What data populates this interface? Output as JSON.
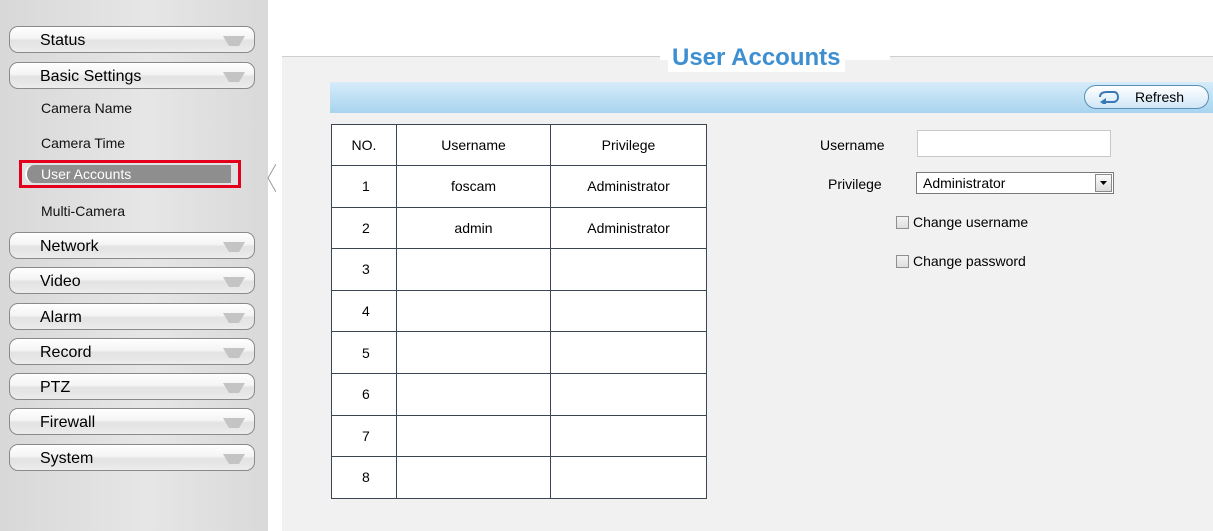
{
  "sidebar": {
    "menu": [
      {
        "label": "Status"
      },
      {
        "label": "Basic Settings"
      },
      {
        "label": "Network"
      },
      {
        "label": "Video"
      },
      {
        "label": "Alarm"
      },
      {
        "label": "Record"
      },
      {
        "label": "PTZ"
      },
      {
        "label": "Firewall"
      },
      {
        "label": "System"
      }
    ],
    "submenu": [
      {
        "label": "Camera Name"
      },
      {
        "label": "Camera Time"
      },
      {
        "label": "User Accounts",
        "active": true
      },
      {
        "label": "Multi-Camera"
      }
    ]
  },
  "main": {
    "title": "User Accounts",
    "refresh_label": "Refresh",
    "table": {
      "headers": [
        "NO.",
        "Username",
        "Privilege"
      ],
      "rows": [
        [
          "1",
          "foscam",
          "Administrator"
        ],
        [
          "2",
          "admin",
          "Administrator"
        ],
        [
          "3",
          "",
          ""
        ],
        [
          "4",
          "",
          ""
        ],
        [
          "5",
          "",
          ""
        ],
        [
          "6",
          "",
          ""
        ],
        [
          "7",
          "",
          ""
        ],
        [
          "8",
          "",
          ""
        ]
      ]
    },
    "form": {
      "username_label": "Username",
      "username_value": "",
      "privilege_label": "Privilege",
      "privilege_value": "Administrator",
      "change_username_label": "Change username",
      "change_username_checked": false,
      "change_password_label": "Change password",
      "change_password_checked": false
    }
  },
  "colors": {
    "title": "#3d8fd1",
    "header_bar": "#a8d4ef",
    "active_highlight_border": "#e4001c"
  },
  "icons": {
    "refresh": "refresh-arrow-icon",
    "menu_arrow": "chevron-down-icon",
    "select_arrow": "dropdown-arrow-icon"
  }
}
